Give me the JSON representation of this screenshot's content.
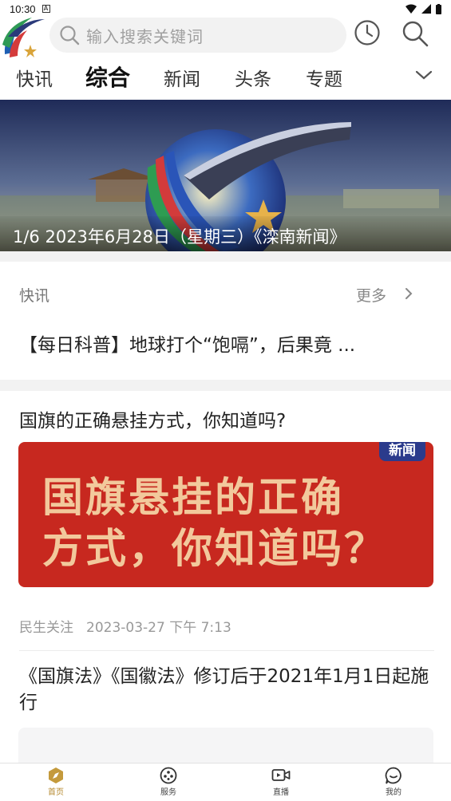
{
  "status_bar": {
    "time": "10:30"
  },
  "header": {
    "search_placeholder": "输入搜索关键词"
  },
  "tabs": [
    {
      "label": "快讯",
      "active": false
    },
    {
      "label": "综合",
      "active": true
    },
    {
      "label": "新闻",
      "active": false
    },
    {
      "label": "头条",
      "active": false
    },
    {
      "label": "专题",
      "active": false
    }
  ],
  "banner": {
    "caption": "1/6 2023年6月28日（星期三）《滦南新闻》"
  },
  "flash": {
    "title": "快讯",
    "more_label": "更多",
    "headline": "【每日科普】地球打个“饱嗝”，后果竟 ..."
  },
  "articles": [
    {
      "title": "国旗的正确悬挂方式，你知道吗?",
      "image_line1": "国旗悬挂的正确",
      "image_line2": "方式，你知道吗？",
      "image_badge": "新闻",
      "category": "民生关注",
      "time": "2023-03-27 下午 7:13"
    },
    {
      "title": "《国旗法》《国徽法》修订后于2021年1月1日起施行"
    }
  ],
  "bottom_nav": [
    {
      "label": "首页",
      "icon": "home-compass-icon",
      "active": true
    },
    {
      "label": "服务",
      "icon": "service-icon",
      "active": false
    },
    {
      "label": "直播",
      "icon": "live-video-icon",
      "active": false
    },
    {
      "label": "我的",
      "icon": "profile-chat-icon",
      "active": false
    }
  ],
  "colors": {
    "accent": "#b5892e",
    "brand_red": "#c7281f",
    "tab_active": "#111111"
  }
}
